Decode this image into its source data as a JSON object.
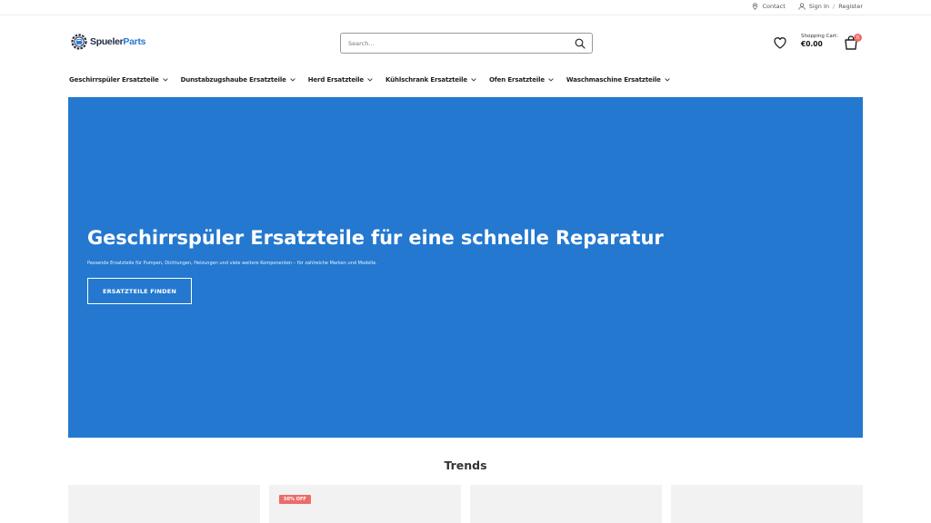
{
  "topbar": {
    "contact": "Contact",
    "sign_in": "Sign In",
    "separator": "/",
    "register": "Register"
  },
  "header": {
    "logo_part1": "Spueler",
    "logo_part2": "Parts",
    "search_placeholder": "Search...",
    "cart_label": "Shopping Cart:",
    "cart_amount": "€0.00",
    "cart_count": "0"
  },
  "nav": {
    "items": [
      "Geschirrspüler Ersatzteile",
      "Dunstabzugshaube Ersatzteile",
      "Herd Ersatzteile",
      "Kühlschrank Ersatzteile",
      "Ofen Ersatzteile",
      "Waschmaschine Ersatzteile"
    ]
  },
  "hero": {
    "title": "Geschirrspüler Ersatzteile für eine schnelle Reparatur",
    "subtitle": "Passende Ersatzteile für Pumpen, Dichtungen, Heizungen und viele weitere Komponenten – für zahlreiche Marken und Modelle.",
    "cta": "ERSATZTEILE FINDEN"
  },
  "trends": {
    "title": "Trends",
    "cards": [
      {
        "badge": ""
      },
      {
        "badge": "50% OFF"
      },
      {
        "badge": ""
      },
      {
        "badge": ""
      }
    ]
  },
  "colors": {
    "hero_bg": "#2478cf",
    "accent": "#2b78d6",
    "badge": "#ee6b6b"
  },
  "icons": [
    "location-pin-icon",
    "user-icon",
    "search-icon",
    "heart-icon",
    "shopping-bag-icon",
    "chevron-down-icon"
  ]
}
